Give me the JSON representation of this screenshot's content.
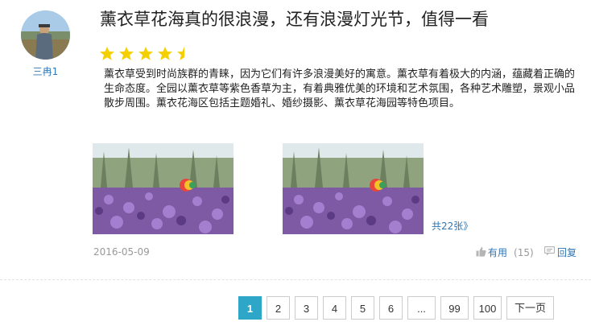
{
  "review": {
    "username": "三冉1",
    "title": "薰衣草花海真的很浪漫，还有浪漫灯光节，值得一看",
    "rating": 4.5,
    "rating_max": 5,
    "content": "薰衣草受到时尚族群的青睐，因为它们有许多浪漫美好的寓意。薰衣草有着极大的内涵，蕴藏着正确的生命态度。全园以薰衣草等紫色香草为主，有着典雅优美的环境和艺术氛围，各种艺术雕塑，景观小品散步周围。薰衣花海区包括主题婚礼、婚纱摄影、薰衣草花海园等特色项目。",
    "photos_link": "共22张》",
    "date": "2016-05-09",
    "useful_label": "有用",
    "useful_count": "(15)",
    "reply_label": "回复"
  },
  "pagination": {
    "pages": [
      "1",
      "2",
      "3",
      "4",
      "5",
      "6",
      "...",
      "99",
      "100",
      "下一页"
    ],
    "active": "1"
  },
  "colors": {
    "star": "#f5d000",
    "link": "#2f76b5",
    "active_page": "#2da6c7",
    "muted": "#999999"
  },
  "icons": {
    "useful": "thumbs-up-icon",
    "reply": "comment-icon"
  }
}
